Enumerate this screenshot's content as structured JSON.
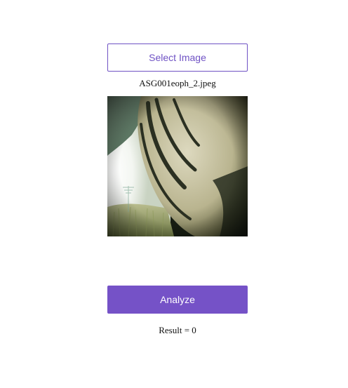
{
  "select_button": {
    "label": "Select Image"
  },
  "selected_file": {
    "name": "ASG001eoph_2.jpeg"
  },
  "analyze_button": {
    "label": "Analyze"
  },
  "result": {
    "text": "Result = 0"
  },
  "colors": {
    "accent": "#7552c7",
    "background": "#ffffff",
    "text": "#111111"
  }
}
